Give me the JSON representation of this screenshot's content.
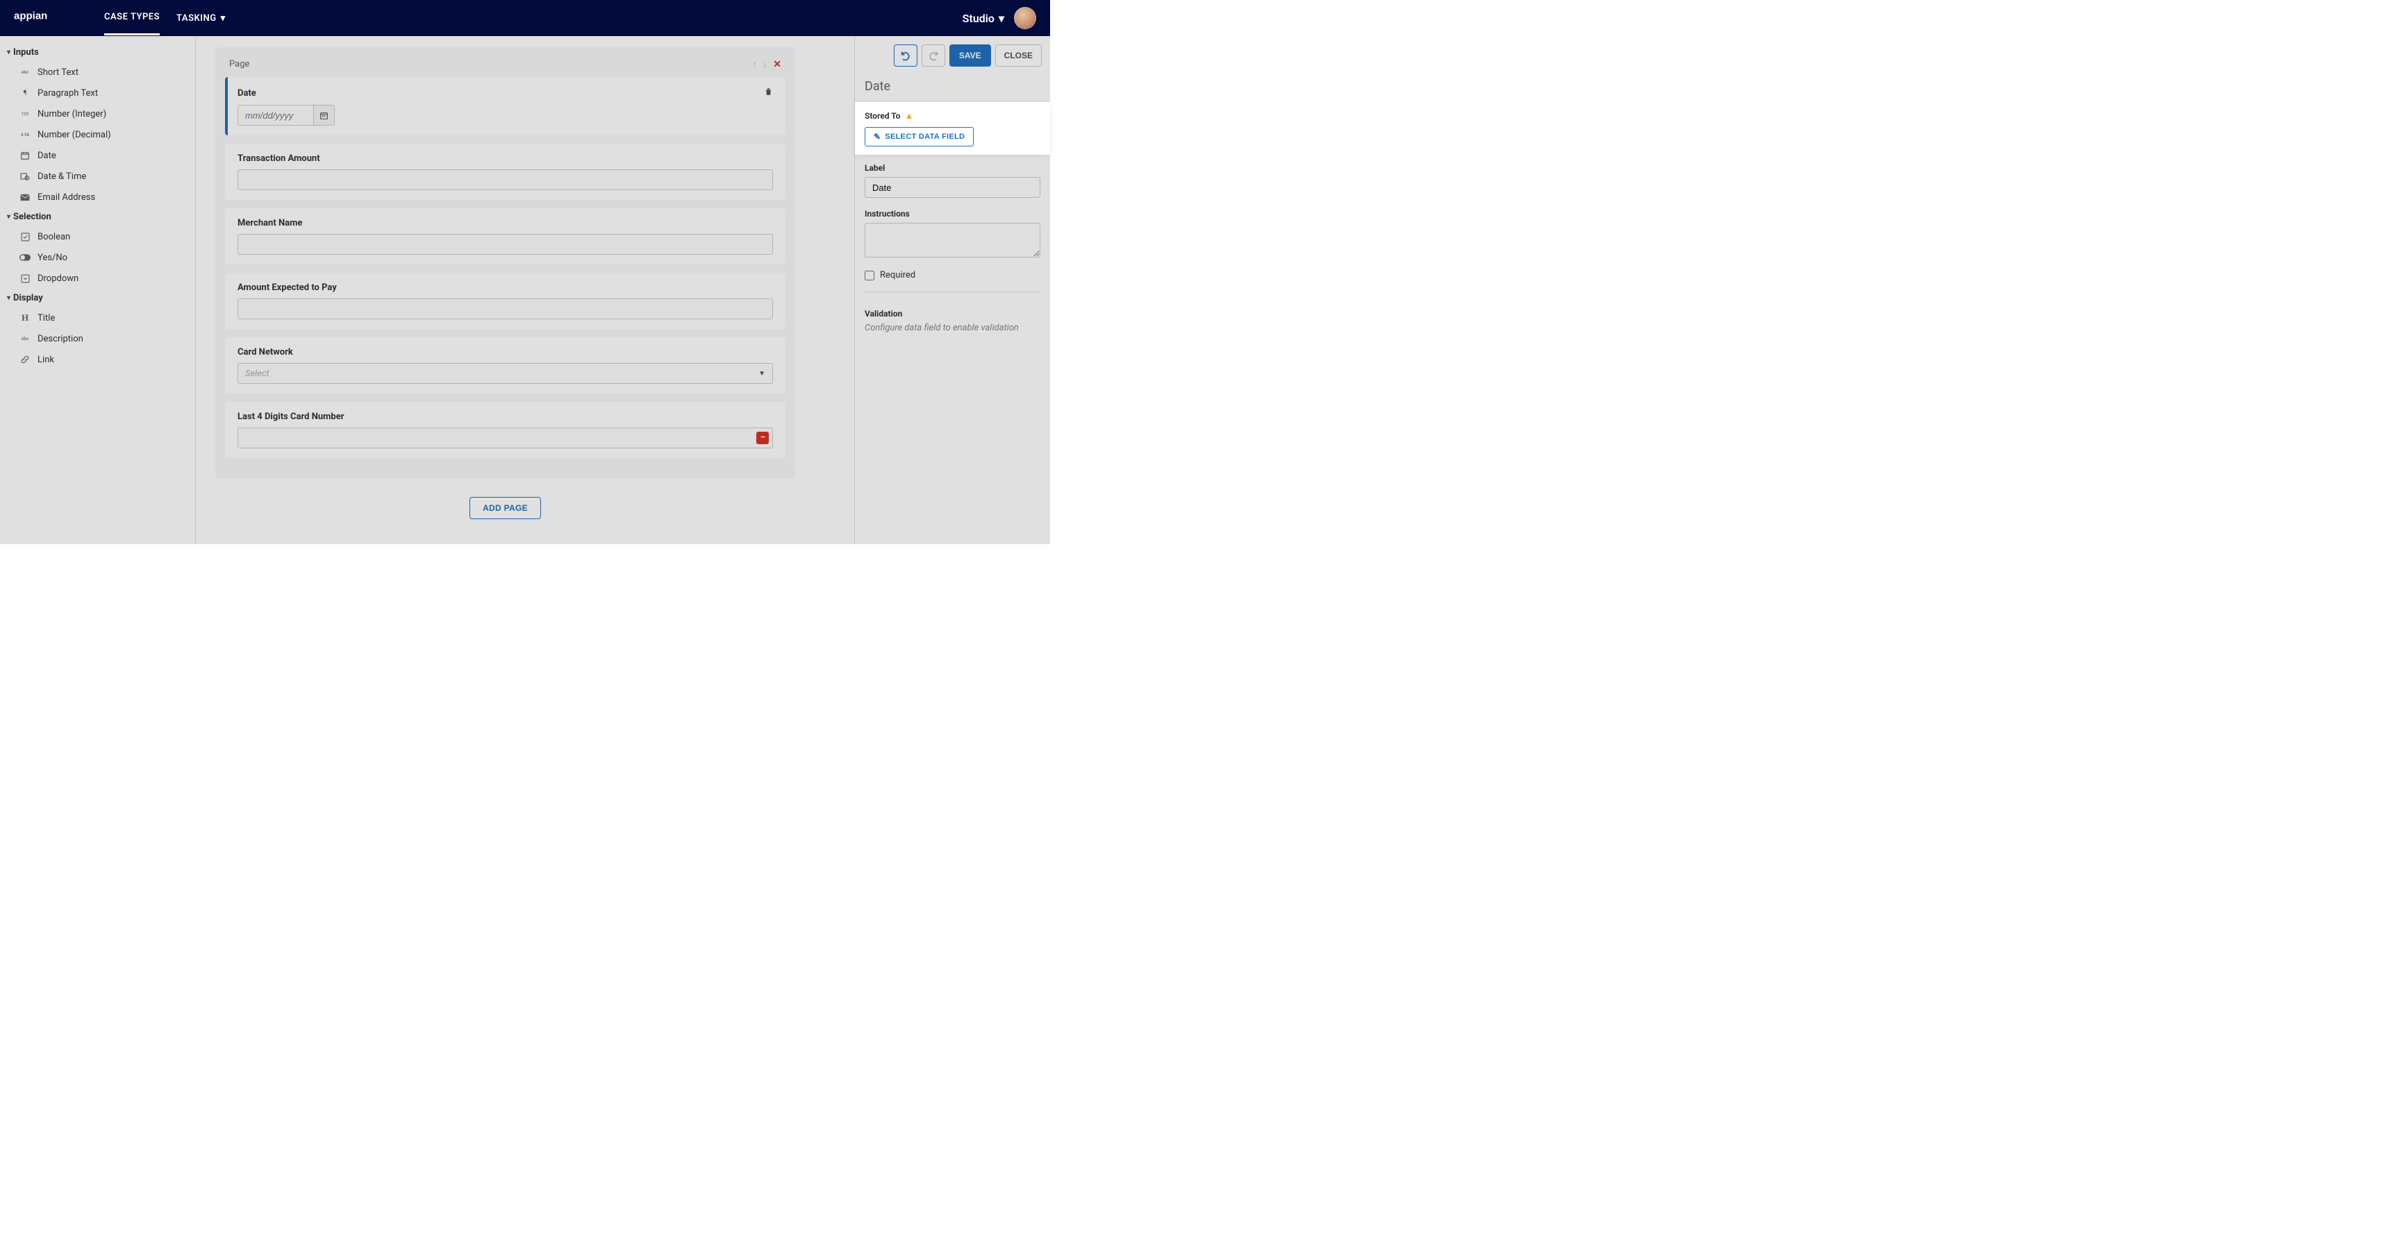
{
  "nav": {
    "brand": "appian",
    "items": [
      "CASE TYPES",
      "TASKING"
    ],
    "studio": "Studio"
  },
  "palette": {
    "groups": [
      {
        "title": "Inputs",
        "items": [
          {
            "label": "Short Text",
            "icon": "Abc"
          },
          {
            "label": "Paragraph Text",
            "icon": "para"
          },
          {
            "label": "Number (Integer)",
            "icon": "123"
          },
          {
            "label": "Number (Decimal)",
            "icon": "4.56"
          },
          {
            "label": "Date",
            "icon": "cal"
          },
          {
            "label": "Date & Time",
            "icon": "clock"
          },
          {
            "label": "Email Address",
            "icon": "mail"
          }
        ]
      },
      {
        "title": "Selection",
        "items": [
          {
            "label": "Boolean",
            "icon": "check"
          },
          {
            "label": "Yes/No",
            "icon": "toggle"
          },
          {
            "label": "Dropdown",
            "icon": "dd"
          }
        ]
      },
      {
        "title": "Display",
        "items": [
          {
            "label": "Title",
            "icon": "H"
          },
          {
            "label": "Description",
            "icon": "Abc"
          },
          {
            "label": "Link",
            "icon": "link"
          }
        ]
      }
    ]
  },
  "canvas": {
    "page_label": "Page",
    "cards": [
      {
        "label": "Date",
        "type": "date",
        "placeholder": "mm/dd/yyyy",
        "selected": true
      },
      {
        "label": "Transaction Amount",
        "type": "text"
      },
      {
        "label": "Merchant Name",
        "type": "text"
      },
      {
        "label": "Amount Expected to Pay",
        "type": "text"
      },
      {
        "label": "Card Network",
        "type": "select",
        "placeholder": "Select"
      },
      {
        "label": "Last 4 Digits Card Number",
        "type": "masked"
      }
    ],
    "add_page": "ADD PAGE"
  },
  "props": {
    "actions": {
      "save": "SAVE",
      "close": "CLOSE"
    },
    "title": "Date",
    "stored_to_label": "Stored To",
    "select_data_field": "SELECT DATA FIELD",
    "label_label": "Label",
    "label_value": "Date",
    "instructions_label": "Instructions",
    "required_label": "Required",
    "validation_label": "Validation",
    "validation_hint": "Configure data field to enable validation"
  }
}
